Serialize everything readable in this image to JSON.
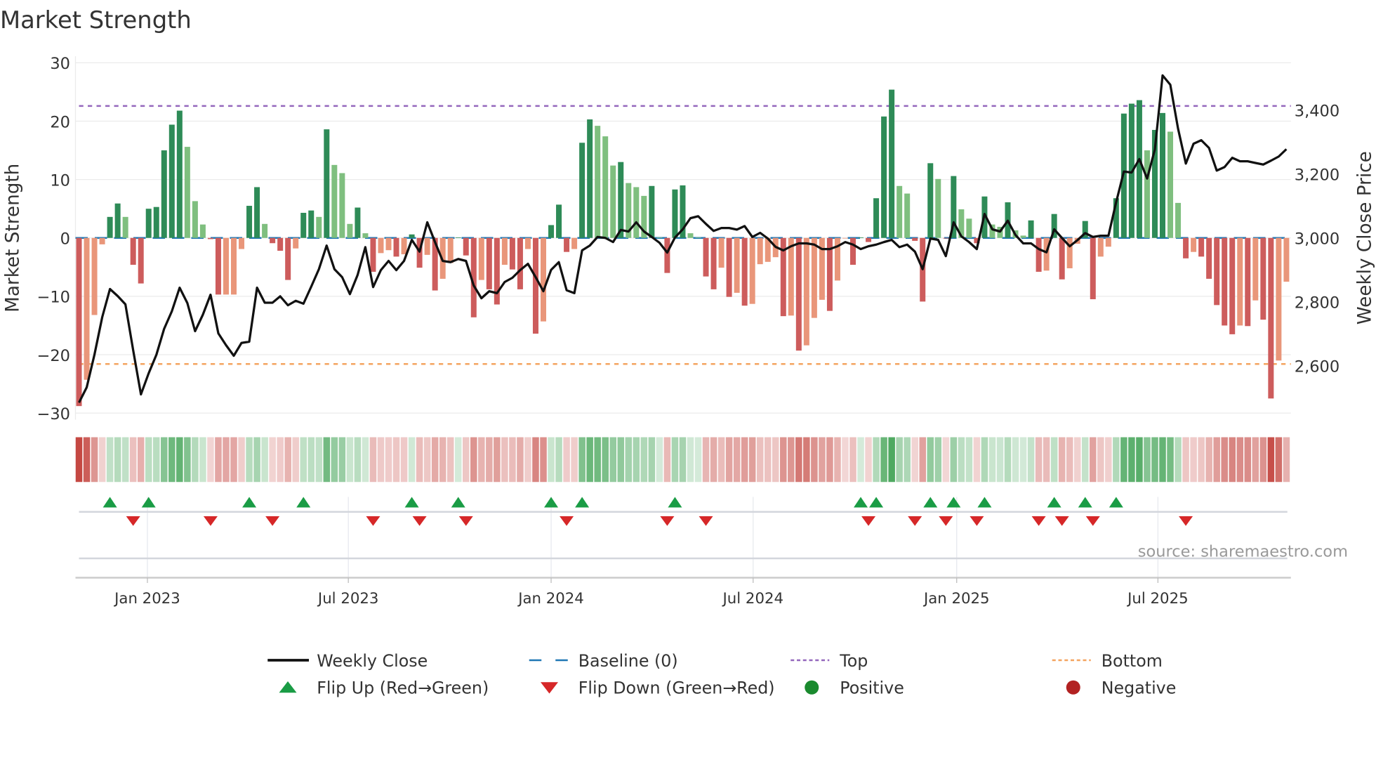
{
  "chart_data": {
    "type": "bar",
    "title": "Market Strength",
    "ylabel": "Market Strength",
    "y2label": "Weekly Close Price",
    "ylim": [
      -30,
      30
    ],
    "y2lim": [
      2449,
      3551
    ],
    "yticks": [
      {
        "v": 30,
        "label": "30"
      },
      {
        "v": 20,
        "label": "20"
      },
      {
        "v": 10,
        "label": "10"
      },
      {
        "v": 0,
        "label": "0"
      },
      {
        "v": -10,
        "label": "−10"
      },
      {
        "v": -20,
        "label": "−20"
      },
      {
        "v": -30,
        "label": "−30"
      }
    ],
    "y2ticks": [
      {
        "v": 3400,
        "label": "3,400"
      },
      {
        "v": 3200,
        "label": "3,200"
      },
      {
        "v": 3000,
        "label": "3,000"
      },
      {
        "v": 2800,
        "label": "2,800"
      },
      {
        "v": 2600,
        "label": "2,600"
      }
    ],
    "xticks": [
      {
        "week": 8.84,
        "label": "Jan 2023"
      },
      {
        "week": 34.8,
        "label": "Jul 2023"
      },
      {
        "week": 61.0,
        "label": "Jan 2024"
      },
      {
        "week": 87.1,
        "label": "Jul 2024"
      },
      {
        "week": 113.4,
        "label": "Jan 2025"
      },
      {
        "week": 139.4,
        "label": "Jul 2025"
      }
    ],
    "top_threshold": 22.6,
    "bottom_threshold": -21.6,
    "baseline": 0,
    "strength": [
      -28.8,
      -24.3,
      -13.2,
      -1.1,
      3.6,
      5.9,
      3.6,
      -4.6,
      -7.8,
      5.0,
      5.3,
      15.0,
      19.4,
      21.8,
      15.6,
      6.3,
      2.3,
      -0.2,
      -9.7,
      -9.7,
      -9.7,
      -1.9,
      5.5,
      8.7,
      2.4,
      -0.9,
      -2.2,
      -7.2,
      -1.8,
      4.3,
      4.7,
      3.6,
      18.6,
      12.5,
      11.1,
      2.4,
      5.2,
      0.8,
      -5.8,
      -2.6,
      -2.1,
      -3.2,
      -2.8,
      0.6,
      -5.1,
      -2.9,
      -9.0,
      -7.0,
      -4.3,
      0.1,
      -3.0,
      -13.6,
      -7.2,
      -8.8,
      -11.4,
      -4.6,
      -5.4,
      -8.8,
      -1.9,
      -16.4,
      -14.3,
      2.2,
      5.7,
      -2.4,
      -1.9,
      16.3,
      20.3,
      19.2,
      17.4,
      12.4,
      13.0,
      9.4,
      8.7,
      7.2,
      8.9,
      0.1,
      -6.0,
      8.3,
      9.0,
      0.8,
      0.1,
      -6.6,
      -8.8,
      -5.1,
      -10.1,
      -9.4,
      -11.6,
      -11.3,
      -4.5,
      -4.1,
      -3.3,
      -13.4,
      -13.3,
      -19.3,
      -18.4,
      -13.7,
      -10.6,
      -12.5,
      -7.3,
      -0.1,
      -4.6,
      0.1,
      -0.7,
      6.8,
      20.8,
      25.4,
      8.9,
      7.6,
      -0.5,
      -10.9,
      12.8,
      10.1,
      -0.1,
      10.6,
      4.9,
      3.3,
      -0.9,
      7.1,
      2.3,
      1.9,
      6.1,
      1.3,
      0.4,
      3.0,
      -5.8,
      -5.6,
      4.1,
      -7.1,
      -5.2,
      -1.0,
      2.9,
      -10.5,
      -3.2,
      -1.5,
      6.8,
      21.3,
      23.0,
      23.6,
      15.0,
      18.5,
      21.4,
      18.2,
      6.0,
      -3.5,
      -2.4,
      -3.2,
      -7.0,
      -11.5,
      -15.0,
      -16.5,
      -15.0,
      -15.1,
      -10.7,
      -14.0,
      -27.5,
      -21.0,
      -7.5
    ],
    "weekly_close": [
      2484,
      2532,
      2634,
      2752,
      2840,
      2818,
      2792,
      2649,
      2510,
      2576,
      2634,
      2715,
      2770,
      2844,
      2796,
      2708,
      2759,
      2822,
      2701,
      2664,
      2631,
      2671,
      2675,
      2844,
      2797,
      2797,
      2817,
      2789,
      2803,
      2794,
      2847,
      2902,
      2976,
      2902,
      2877,
      2824,
      2884,
      2971,
      2846,
      2899,
      2928,
      2899,
      2928,
      2994,
      2957,
      3049,
      2987,
      2928,
      2924,
      2934,
      2928,
      2851,
      2811,
      2833,
      2827,
      2862,
      2875,
      2899,
      2919,
      2877,
      2833,
      2900,
      2924,
      2836,
      2827,
      2961,
      2976,
      3003,
      3000,
      2987,
      3025,
      3020,
      3049,
      3020,
      3003,
      2985,
      2954,
      3001,
      3027,
      3062,
      3068,
      3044,
      3022,
      3031,
      3031,
      3026,
      3037,
      3003,
      3016,
      2998,
      2972,
      2961,
      2974,
      2983,
      2983,
      2979,
      2965,
      2965,
      2974,
      2987,
      2979,
      2965,
      2974,
      2979,
      2987,
      2994,
      2971,
      2979,
      2957,
      2902,
      2998,
      2994,
      2943,
      3049,
      3005,
      2987,
      2965,
      3075,
      3027,
      3020,
      3054,
      3009,
      2983,
      2983,
      2965,
      2955,
      3027,
      3000,
      2974,
      2993,
      3015,
      3003,
      3007,
      3007,
      3112,
      3208,
      3205,
      3247,
      3186,
      3277,
      3509,
      3480,
      3343,
      3233,
      3295,
      3306,
      3282,
      3211,
      3222,
      3251,
      3240,
      3240,
      3235,
      3230,
      3242,
      3255,
      3278
    ],
    "flip_up_weeks": [
      4,
      9,
      22,
      29,
      43,
      49,
      61,
      65,
      77,
      101,
      103,
      110,
      113,
      117,
      126,
      130,
      134
    ],
    "flip_down_weeks": [
      7,
      17,
      25,
      38,
      44,
      50,
      63,
      76,
      81,
      102,
      108,
      112,
      116,
      124,
      127,
      131,
      143
    ],
    "colors": {
      "pos_strong": "#2e8b57",
      "pos_weak": "#7fbf7f",
      "neg_strong": "#cd5c5c",
      "neg_weak": "#e9967a",
      "close": "#111111",
      "baseline": "#1f77b4",
      "top": "#9467bd",
      "bottom": "#f4a460",
      "flip_up": "#1a9c45",
      "flip_down": "#d62728",
      "positive": "#1a8a2e",
      "negative": "#b22222"
    },
    "legend": [
      {
        "key": "close",
        "label": "Weekly Close"
      },
      {
        "key": "baseline",
        "label": "Baseline (0)"
      },
      {
        "key": "top",
        "label": "Top"
      },
      {
        "key": "bottom",
        "label": "Bottom"
      },
      {
        "key": "flip_up",
        "label": "Flip Up (Red→Green)"
      },
      {
        "key": "flip_down",
        "label": "Flip Down (Green→Red)"
      },
      {
        "key": "positive",
        "label": "Positive"
      },
      {
        "key": "negative",
        "label": "Negative"
      }
    ],
    "source": "source: sharemaestro.com"
  }
}
